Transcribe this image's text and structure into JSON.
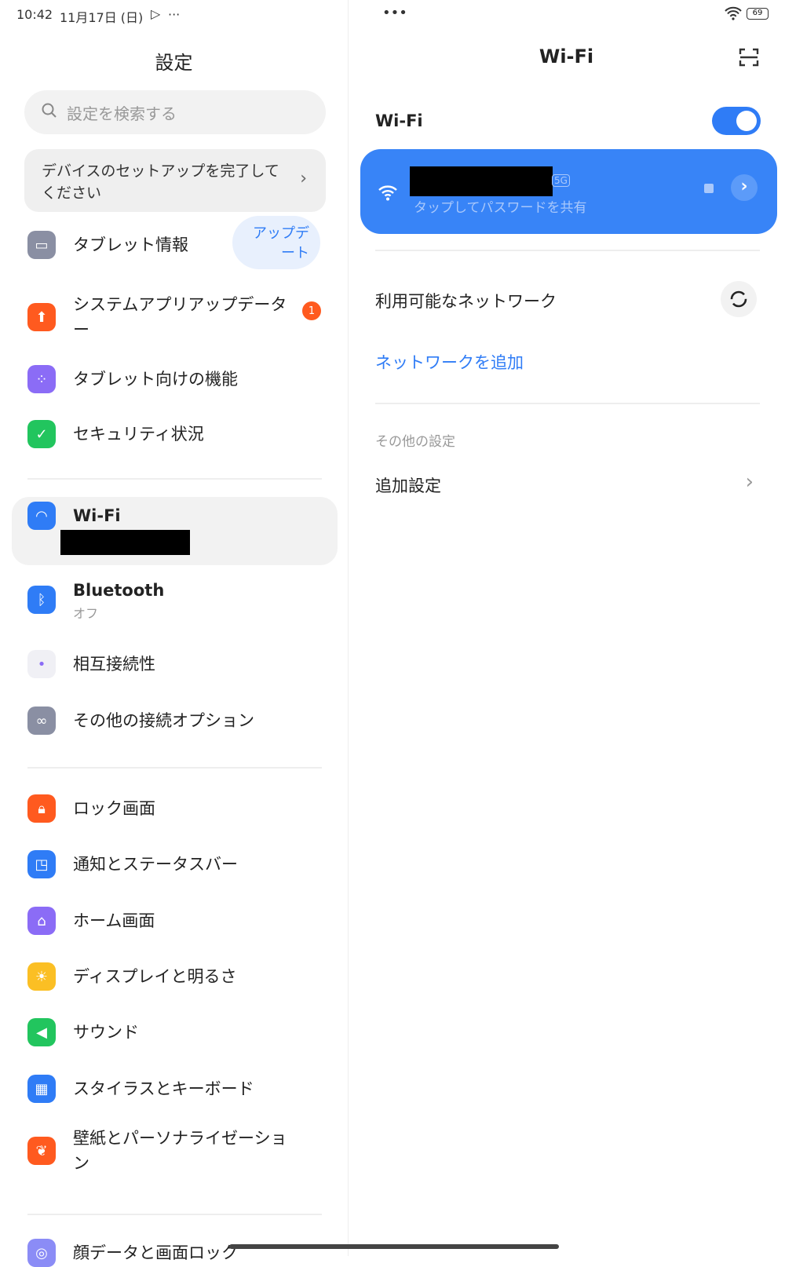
{
  "status_bar": {
    "time": "10:42",
    "date": "11月17日 (日)",
    "more": "···",
    "center_dots": "•••",
    "battery": "69"
  },
  "left": {
    "title": "設定",
    "search_placeholder": "設定を検索する",
    "setup_banner": "デバイスのセットアップを完了してください",
    "update_pill": "アップデート",
    "items": [
      {
        "label": "タブレット情報",
        "icon": "tablet-icon",
        "color": "#8a8fa3"
      },
      {
        "label": "システムアプリアップデーター",
        "icon": "arrow-up-icon",
        "color": "#ff5a1f",
        "badge": "1"
      },
      {
        "label": "タブレット向けの機能",
        "icon": "grid-icon",
        "color": "#8b6cf6"
      },
      {
        "label": "セキュリティ状況",
        "icon": "shield-check-icon",
        "color": "#22c55e"
      },
      {
        "label": "Wi-Fi",
        "icon": "wifi-icon",
        "color": "#2f7cf6"
      },
      {
        "label": "Bluetooth",
        "sub": "オフ",
        "icon": "bluetooth-icon",
        "color": "#2f7cf6"
      },
      {
        "label": "相互接続性",
        "icon": "dots-icon",
        "color": "#f0f0f5"
      },
      {
        "label": "その他の接続オプション",
        "icon": "link-icon",
        "color": "#8a8fa3"
      },
      {
        "label": "ロック画面",
        "icon": "lock-icon",
        "color": "#ff5a1f"
      },
      {
        "label": "通知とステータスバー",
        "icon": "notification-icon",
        "color": "#2f7cf6"
      },
      {
        "label": "ホーム画面",
        "icon": "home-icon",
        "color": "#8b6cf6"
      },
      {
        "label": "ディスプレイと明るさ",
        "icon": "sun-icon",
        "color": "#fbbf24"
      },
      {
        "label": "サウンド",
        "icon": "speaker-icon",
        "color": "#22c55e"
      },
      {
        "label": "スタイラスとキーボード",
        "icon": "keyboard-icon",
        "color": "#2f7cf6"
      },
      {
        "label": "壁紙とパーソナライゼーション",
        "icon": "tulip-icon",
        "color": "#ff5a1f"
      },
      {
        "label": "顔データと画面ロック",
        "icon": "fingerprint-icon",
        "color": "#8b8cf6"
      }
    ]
  },
  "right": {
    "title": "Wi-Fi",
    "toggle_label": "Wi-Fi",
    "wifi_enabled": true,
    "connected_band": "5G",
    "connected_sub": "タップしてパスワードを共有",
    "available_networks": "利用可能なネットワーク",
    "add_network": "ネットワークを追加",
    "other_settings_header": "その他の設定",
    "additional_settings": "追加設定"
  },
  "colors": {
    "accent": "#2f7cf6",
    "badge": "#ff5a1f"
  }
}
